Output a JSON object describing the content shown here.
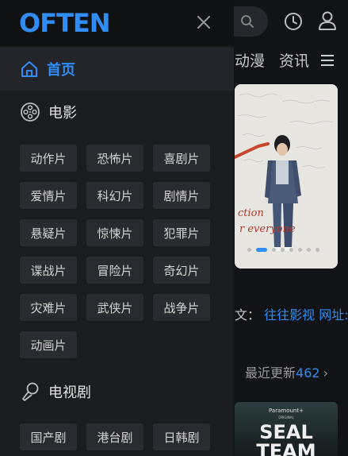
{
  "drawer": {
    "logo": "OFTEN",
    "home_label": "首页",
    "movie_section": {
      "title": "电影",
      "icon": "film-reel-icon",
      "genres": [
        "动作片",
        "恐怖片",
        "喜剧片",
        "爱情片",
        "科幻片",
        "剧情片",
        "悬疑片",
        "惊悚片",
        "犯罪片",
        "谍战片",
        "冒险片",
        "奇幻片",
        "灾难片",
        "武侠片",
        "战争片",
        "动画片"
      ]
    },
    "tv_section": {
      "title": "电视剧",
      "icon": "microphone-icon",
      "genres": [
        "国产剧",
        "港台剧",
        "日韩剧"
      ]
    }
  },
  "background": {
    "tabs": [
      "动漫",
      "资讯"
    ],
    "notice_prefix": "文：",
    "notice_link": "往往影视 网址:",
    "recent_label": "最近更新",
    "recent_count": "462",
    "recent_chevron": "›",
    "banner_handwriting": "ction\nr everyone",
    "poster_brand": "Paramount+",
    "poster_brand_sub": "ORIGINAL",
    "poster_title_1": "SEAL",
    "poster_title_2": "TEAM"
  },
  "colors": {
    "accent": "#2f8df5",
    "drawer_bg": "#1b1c20",
    "chip_bg": "#2a2b30"
  }
}
